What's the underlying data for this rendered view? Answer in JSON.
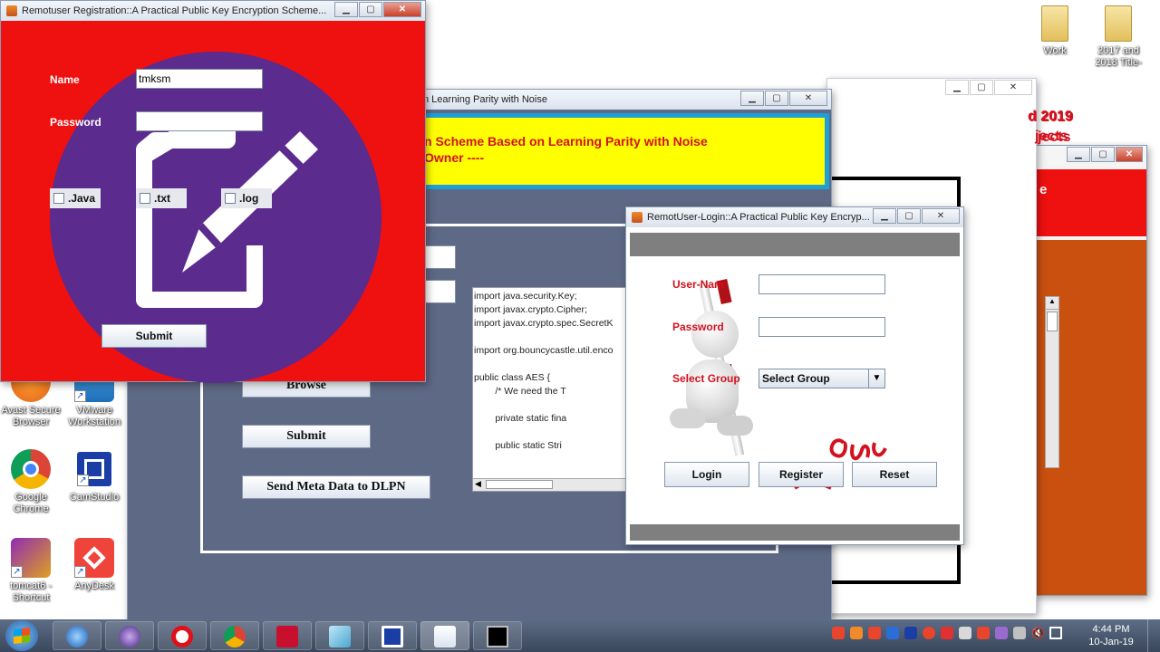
{
  "desktop": {
    "icons": [
      {
        "label": "Work",
        "type": "folder"
      },
      {
        "label": "2017 and\n2018 Title-",
        "type": "folder"
      },
      {
        "label": "Avast Secure\nBrowser"
      },
      {
        "label": "VMware\nWorkstation"
      },
      {
        "label": "Google\nChrome"
      },
      {
        "label": "CamStudio"
      },
      {
        "label": "tomcat6 -\nShortcut"
      },
      {
        "label": "AnyDesk"
      }
    ]
  },
  "bg_window_right": {
    "red_text_1": "d 2019",
    "red_text_2": "jects",
    "letter": "e"
  },
  "owner_window": {
    "title_fragment": "n Learning Parity with Noise",
    "header_line1": "n Scheme Based on Learning Parity with Noise",
    "header_line2": "Owner ----",
    "buttons": {
      "browse": "Browse",
      "submit": "Submit",
      "send": "Send Meta Data to DLPN"
    },
    "code_lines": [
      "import java.security.Key;",
      "import javax.crypto.Cipher;",
      "import javax.crypto.spec.SecretK",
      "",
      "import org.bouncycastle.util.enco",
      "",
      "public class AES {",
      "        /* We need the T",
      "",
      "        private static fina",
      "",
      "        public static Stri"
    ]
  },
  "registration_window": {
    "title": "Remotuser Registration::A Practical Public Key Encryption Scheme...",
    "name_label": "Name",
    "name_value": "tmksm",
    "password_label": "Password",
    "checkboxes": [
      ".Java",
      ".txt",
      ".log"
    ],
    "submit_label": "Submit"
  },
  "login_window": {
    "title": "RemotUser-Login::A Practical Public Key Encryp...",
    "username_label": "User-Nam",
    "password_label": "Password",
    "group_label": "Select Group",
    "group_value": "Select Group",
    "buttons": {
      "login": "Login",
      "register": "Register",
      "reset": "Reset"
    }
  },
  "taskbar": {
    "clock_time": "4:44 PM",
    "clock_date": "10-Jan-19",
    "colors": {
      "accent": "#3a475c"
    }
  },
  "colors": {
    "reg_bg": "#ef1010",
    "reg_circle": "#5b2b8e",
    "owner_panel": "#5e6985",
    "owner_header": "#ffff00",
    "owner_header_border": "#1e9fd8",
    "right_window_orange": "#c9500f"
  }
}
